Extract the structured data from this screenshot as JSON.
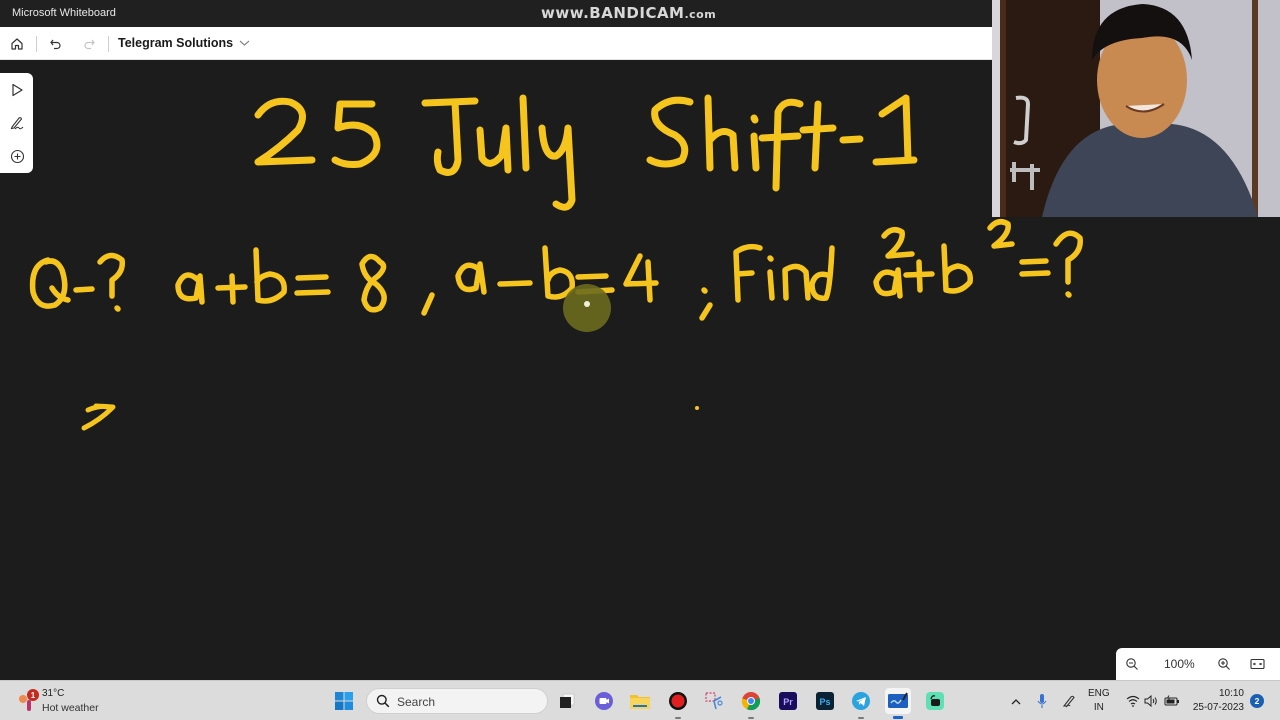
{
  "window": {
    "app_title": "Microsoft Whiteboard",
    "recorder_watermark_main": "www.BANDICAM",
    "recorder_watermark_suffix": ".com"
  },
  "toolbar": {
    "home_icon": "home-icon",
    "undo_icon": "undo-icon",
    "redo_icon": "redo-icon",
    "board_name": "Telegram Solutions",
    "board_menu_icon": "chevron-down-icon"
  },
  "left_tools": [
    {
      "name": "select",
      "icon": "cursor-icon"
    },
    {
      "name": "ink",
      "icon": "pen-icon"
    },
    {
      "name": "insert",
      "icon": "plus-circle-icon"
    }
  ],
  "board_ink": {
    "color": "#f5c51e",
    "heading": "25 July Shift-1",
    "question_line": "Q-? a+b = 8 , a-b = 4 ; Find a^2+b^2 = ?",
    "question_parts": {
      "label": "Q-?",
      "eq1": "a+b = 8",
      "eq2": "a-b = 4",
      "ask": "Find a²+b² = ?"
    },
    "answer_start": "→"
  },
  "laser_pointer": {
    "color": "#6b6b1e"
  },
  "webcam": {
    "description": "presenter webcam overlay"
  },
  "zoom_bar": {
    "zoom_out_icon": "zoom-out-icon",
    "zoom_level": "100%",
    "zoom_in_icon": "zoom-in-icon",
    "fit_icon": "fit-to-screen-icon"
  },
  "taskbar": {
    "weather": {
      "temp": "31°C",
      "desc": "Hot weather",
      "badge": "1"
    },
    "search_placeholder": "Search",
    "apps": [
      {
        "name": "start",
        "icon": "windows-start-icon"
      },
      {
        "name": "task-view",
        "icon": "task-view-icon"
      },
      {
        "name": "meet",
        "icon": "video-chat-icon"
      },
      {
        "name": "file-explorer",
        "icon": "folder-icon"
      },
      {
        "name": "bandicam",
        "icon": "record-icon"
      },
      {
        "name": "snipping-tool",
        "icon": "scissors-icon"
      },
      {
        "name": "chrome",
        "icon": "chrome-icon"
      },
      {
        "name": "premiere-pro",
        "icon": "premiere-icon",
        "label": "Pr"
      },
      {
        "name": "photoshop",
        "icon": "photoshop-icon",
        "label": "Ps"
      },
      {
        "name": "telegram",
        "icon": "telegram-icon"
      },
      {
        "name": "whiteboard",
        "icon": "whiteboard-icon",
        "active": true
      },
      {
        "name": "app-green",
        "icon": "green-app-icon"
      }
    ],
    "tray": {
      "language_line1": "ENG",
      "language_line2": "IN",
      "time": "10:10",
      "date": "25-07-2023",
      "notification_count": "2"
    }
  }
}
